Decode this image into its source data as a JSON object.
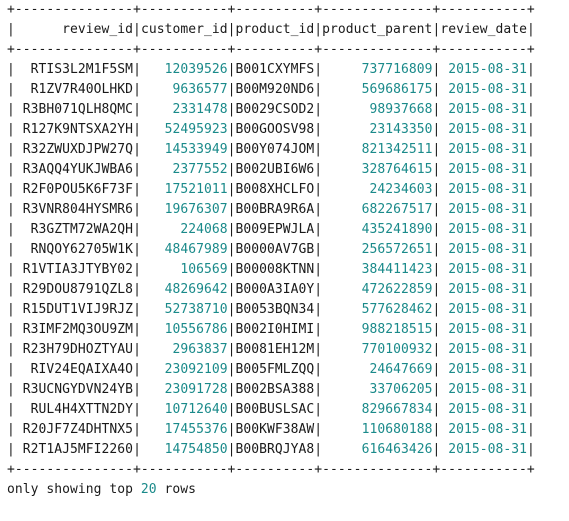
{
  "table": {
    "border": "+---------------+-----------+----------+--------------+-----------+",
    "headers": [
      "review_id",
      "customer_id",
      "product_id",
      "product_parent",
      "review_date"
    ],
    "rows": [
      [
        "RTIS3L2M1F5SM",
        "12039526",
        "B001CXYMFS",
        "737716809",
        "2015-08-31"
      ],
      [
        "R1ZV7R40OLHKD",
        "9636577",
        "B00M920ND6",
        "569686175",
        "2015-08-31"
      ],
      [
        "R3BH071QLH8QMC",
        "2331478",
        "B0029CSOD2",
        "98937668",
        "2015-08-31"
      ],
      [
        "R127K9NTSXA2YH",
        "52495923",
        "B00GOOSV98",
        "23143350",
        "2015-08-31"
      ],
      [
        "R32ZWUXDJPW27Q",
        "14533949",
        "B00Y074JOM",
        "821342511",
        "2015-08-31"
      ],
      [
        "R3AQQ4YUKJWBA6",
        "2377552",
        "B002UBI6W6",
        "328764615",
        "2015-08-31"
      ],
      [
        "R2F0POU5K6F73F",
        "17521011",
        "B008XHCLFO",
        "24234603",
        "2015-08-31"
      ],
      [
        "R3VNR804HYSMR6",
        "19676307",
        "B00BRA9R6A",
        "682267517",
        "2015-08-31"
      ],
      [
        "R3GZTM72WA2QH",
        "224068",
        "B009EPWJLA",
        "435241890",
        "2015-08-31"
      ],
      [
        "RNQOY62705W1K",
        "48467989",
        "B0000AV7GB",
        "256572651",
        "2015-08-31"
      ],
      [
        "R1VTIA3JTYBY02",
        "106569",
        "B00008KTNN",
        "384411423",
        "2015-08-31"
      ],
      [
        "R29DOU8791QZL8",
        "48269642",
        "B000A3IA0Y",
        "472622859",
        "2015-08-31"
      ],
      [
        "R15DUT1VIJ9RJZ",
        "52738710",
        "B0053BQN34",
        "577628462",
        "2015-08-31"
      ],
      [
        "R3IMF2MQ3OU9ZM",
        "10556786",
        "B002I0HIMI",
        "988218515",
        "2015-08-31"
      ],
      [
        "R23H79DHOZTYAU",
        "2963837",
        "B0081EH12M",
        "770100932",
        "2015-08-31"
      ],
      [
        "RIV24EQAIXA4O",
        "23092109",
        "B005FMLZQQ",
        "24647669",
        "2015-08-31"
      ],
      [
        "R3UCNGYDVN24YB",
        "23091728",
        "B002BSA388",
        "33706205",
        "2015-08-31"
      ],
      [
        "RUL4H4XTTN2DY",
        "10712640",
        "B00BUSLSAC",
        "829667834",
        "2015-08-31"
      ],
      [
        "R20JF7Z4DHTNX5",
        "17455376",
        "B00KWF38AW",
        "110680188",
        "2015-08-31"
      ],
      [
        "R2T1AJ5MFI2260",
        "14754850",
        "B00BRQJYA8",
        "616463426",
        "2015-08-31"
      ]
    ]
  },
  "footer": {
    "prefix": "only showing top ",
    "count": "20",
    "suffix": " rows"
  },
  "colors": {
    "number": "#1a8a8a",
    "text": "#1a1a1a"
  }
}
